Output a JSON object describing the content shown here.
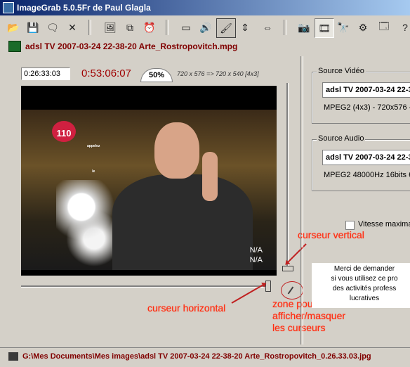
{
  "window": {
    "title": "ImageGrab 5.0.5Fr de Paul Glagla"
  },
  "toolbar": {
    "buttons": [
      {
        "name": "open-icon",
        "glyph": "📂"
      },
      {
        "name": "save-icon",
        "glyph": "💾"
      },
      {
        "name": "comment-icon",
        "glyph": "🗨"
      },
      {
        "name": "close-icon",
        "glyph": "✕"
      },
      {
        "name": "image-icon",
        "glyph": "🖼"
      },
      {
        "name": "copy-icon",
        "glyph": "⧉"
      },
      {
        "name": "alarm-icon",
        "glyph": "⏰"
      },
      {
        "name": "fullscreen-icon",
        "glyph": "▭"
      },
      {
        "name": "speaker-icon",
        "glyph": "🔊"
      },
      {
        "name": "brush-icon",
        "glyph": "🖌"
      },
      {
        "name": "vertical-resize-icon",
        "glyph": "⇕"
      },
      {
        "name": "horizontal-resize-icon",
        "glyph": "⇔"
      },
      {
        "name": "camera-icon",
        "glyph": "📷"
      },
      {
        "name": "film-icon",
        "glyph": "🎞"
      },
      {
        "name": "binoculars-icon",
        "glyph": "🔭"
      },
      {
        "name": "settings-icon",
        "glyph": "⚙"
      },
      {
        "name": "properties-icon",
        "glyph": "🗔"
      },
      {
        "name": "help-icon",
        "glyph": "?"
      }
    ]
  },
  "file": {
    "name": "adsl TV 2007-03-24 22-38-20 Arte_Rostropovitch.mpg"
  },
  "player": {
    "current_time": "0:26:33:03",
    "duration": "0:53:06:07",
    "zoom": "50%",
    "resolution": "720 x 576  =>  720 x 540 [4x3]",
    "logo_small": "appelez le",
    "logo_number": "110",
    "overlay_line1": "N/A",
    "overlay_line2": "N/A"
  },
  "annotations": {
    "vertical_cursor": "curseur vertical",
    "horizontal_cursor": "curseur horizontal",
    "toggle_zone_line1": "zone pour",
    "toggle_zone_line2": "afficher/masquer",
    "toggle_zone_line3": "les curseurs"
  },
  "video_source": {
    "title": "Source Vidéo",
    "combo": "adsl TV 2007-03-24 22-3",
    "info": "MPEG2 (4x3) - 720x576 -"
  },
  "audio_source": {
    "title": "Source Audio",
    "combo": "adsl TV 2007-03-24 22-3",
    "info": "MPEG2 48000Hz 16bits  6"
  },
  "options": {
    "max_speed_label": "Vitesse maxima"
  },
  "info_box": {
    "line1": "Merci de demander",
    "line2": "si vous utilisez ce pro",
    "line3": "des activités profess",
    "line4": "lucratives"
  },
  "status": {
    "path": "G:\\Mes Documents\\Mes images\\adsl TV 2007-03-24 22-38-20 Arte_Rostropovitch_0.26.33.03.jpg"
  }
}
